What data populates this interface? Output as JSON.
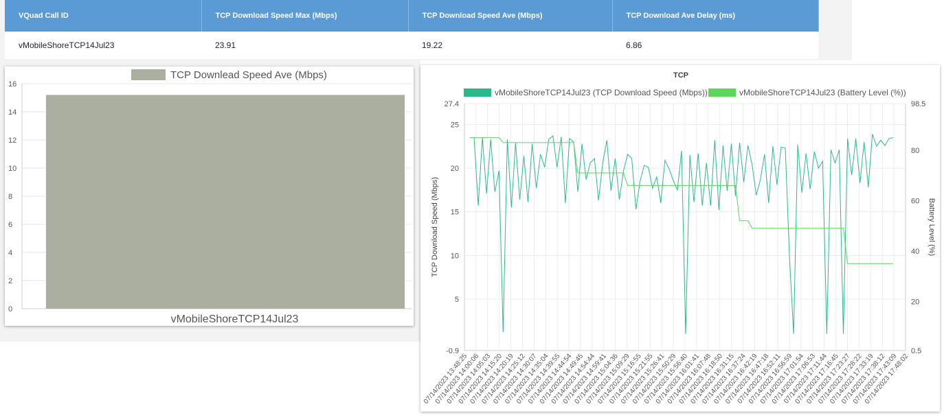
{
  "table": {
    "headers": [
      "VQuad Call ID",
      "TCP Download Speed Max (Mbps)",
      "TCP Download Speed Ave (Mbps)",
      "TCP Download Ave Delay (ms)"
    ],
    "rows": [
      [
        "vMobileShoreTCP14Jul23",
        "23.91",
        "19.22",
        "6.86"
      ]
    ]
  },
  "chart_data": [
    {
      "type": "bar",
      "legend": "TCP Downlead Speed Ave (Mbps)",
      "categories": [
        "vMobileShoreTCP14Jul23"
      ],
      "values": [
        15.2
      ],
      "ylim": [
        0,
        16
      ],
      "yticks": [
        "0",
        "2",
        "4",
        "6",
        "8",
        "10",
        "12",
        "14",
        "16"
      ],
      "color": "#abafa0",
      "grid": true,
      "legend_position": "top"
    },
    {
      "type": "line",
      "title": "TCP",
      "ylabel": "TCP Download Speed (Mbps)",
      "y2label": "Battery Level (%)",
      "ylim": [
        -0.9,
        27.4
      ],
      "y2lim": [
        0.5,
        98.5
      ],
      "yticks": [
        "-0.9",
        "5",
        "10",
        "15",
        "20",
        "25",
        "27.4"
      ],
      "y2ticks": [
        "0.5",
        "20",
        "40",
        "60",
        "80",
        "98.5"
      ],
      "grid": true,
      "legend_position": "top",
      "xlabels": [
        "07/14/2023 13:48:25",
        "07/14/2023 14:00:06",
        "07/14/2023 14:05:03",
        "07/14/2023 14:15:20",
        "07/14/2023 14:20:19",
        "07/14/2023 14:25:12",
        "07/14/2023 14:30:07",
        "07/14/2023 14:35:04",
        "07/14/2023 14:39:55",
        "07/14/2023 14:44:54",
        "07/14/2023 14:49:45",
        "07/14/2023 14:54:44",
        "07/14/2023 14:59:41",
        "07/14/2023 15:04:36",
        "07/14/2023 15:09:29",
        "07/14/2023 15:16:55",
        "07/14/2023 15:21:55",
        "07/14/2023 15:26:41",
        "07/14/2023 15:50:29",
        "07/14/2023 15:56:40",
        "07/14/2023 16:01:41",
        "07/14/2023 16:07:48",
        "07/14/2023 16:18:50",
        "07/14/2023 16:31:15",
        "07/14/2023 16:37:24",
        "07/14/2023 16:42:19",
        "07/14/2023 16:47:18",
        "07/14/2023 16:52:11",
        "07/14/2023 16:56:59",
        "07/14/2023 17:01:54",
        "07/14/2023 17:06:53",
        "07/14/2023 17:11:44",
        "07/14/2023 17:16:45",
        "07/14/2023 17:23:27",
        "07/14/2023 17:28:22",
        "07/14/2023 17:33:19",
        "07/14/2023 17:38:12",
        "07/14/2023 17:43:09",
        "07/14/2023 17:48:02"
      ],
      "series": [
        {
          "name": "vMobileShoreTCP14Jul23 (TCP Download Speed (Mbps))",
          "color": "#2bb98c",
          "axis": "left",
          "values": [
            23.5,
            23.5,
            15.7,
            23.5,
            17.1,
            23.3,
            17.3,
            19.7,
            1.2,
            23.3,
            15.5,
            22.9,
            16.4,
            21.4,
            16.1,
            22.8,
            17.7,
            21.6,
            20.1,
            23.3,
            23.7,
            20.1,
            23.6,
            16.0,
            23.4,
            23.0,
            17.3,
            22.8,
            18.7,
            20.6,
            21.1,
            16.3,
            20.6,
            23.2,
            17.4,
            21.1,
            16.4,
            19.7,
            21.6,
            21.1,
            15.3,
            18.5,
            20.3,
            20.1,
            17.7,
            19.0,
            16.0,
            20.9,
            19.9,
            18.6,
            17.5,
            22.0,
            1.0,
            21.5,
            16.1,
            21.7,
            15.7,
            20.6,
            15.7,
            23.2,
            15.2,
            22.6,
            17.4,
            22.8,
            16.8,
            22.9,
            18.4,
            22.6,
            20.4,
            16.9,
            18.7,
            21.6,
            16.0,
            22.5,
            18.1,
            22.4,
            22.3,
            10.0,
            1.0,
            22.7,
            17.2,
            21.7,
            17.6,
            21.9,
            20.0,
            20.8,
            1.0,
            22.1,
            20.6,
            22.1,
            1.0,
            23.4,
            19.2,
            23.4,
            18.3,
            23.0,
            17.8,
            23.9,
            22.5,
            23.2,
            22.6,
            23.4,
            23.5
          ]
        },
        {
          "name": "vMobileShoreTCP14Jul23 (Battery Level (%))",
          "color": "#5cd65c",
          "axis": "right",
          "values": [
            85,
            85,
            85,
            85,
            85,
            85,
            85,
            85,
            83,
            83,
            83,
            83,
            83,
            83,
            83,
            83,
            83,
            83,
            83,
            83,
            83,
            83,
            83,
            83,
            83,
            83,
            71,
            71,
            71,
            71,
            71,
            71,
            71,
            71,
            71,
            71,
            71,
            71,
            66,
            66,
            66,
            66,
            66,
            66,
            66,
            66,
            66,
            66,
            66,
            66,
            66,
            66,
            66,
            66,
            66,
            66,
            66,
            66,
            66,
            66,
            66,
            66,
            66,
            66,
            66,
            52,
            52,
            52,
            49,
            49,
            49,
            49,
            49,
            49,
            49,
            49,
            49,
            49,
            49,
            49,
            49,
            49,
            49,
            49,
            49,
            49,
            49,
            49,
            49,
            49,
            49,
            35,
            35,
            35,
            35,
            35,
            35,
            35,
            35,
            35,
            35,
            35,
            35
          ]
        }
      ]
    }
  ]
}
